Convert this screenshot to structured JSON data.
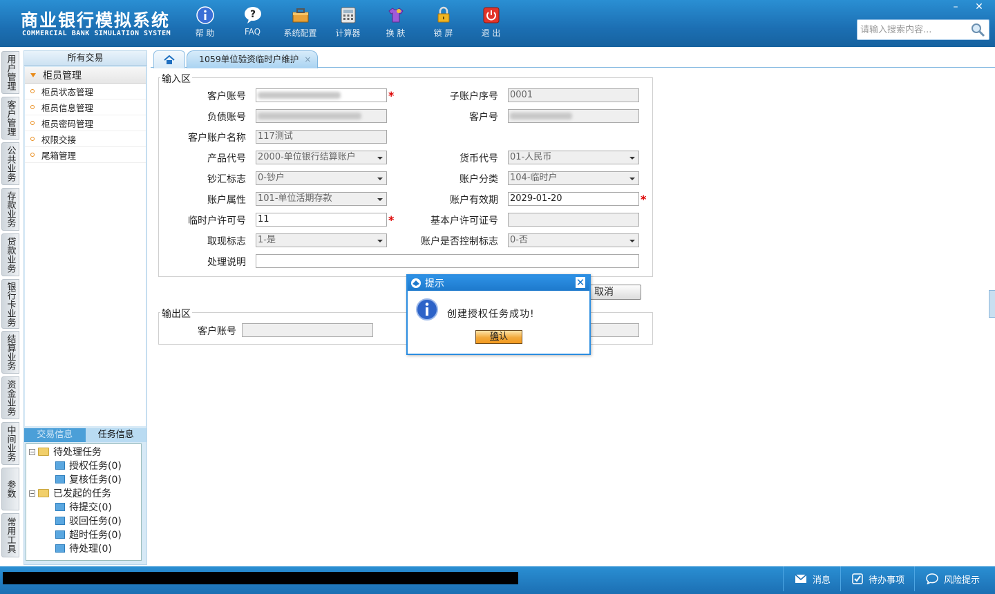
{
  "header": {
    "title_cn": "商业银行模拟系统",
    "title_en": "COMMERCIAL BANK SIMULATION SYSTEM",
    "toolbar": [
      {
        "label": "帮 助",
        "icon": "info-icon"
      },
      {
        "label": "FAQ",
        "icon": "faq-icon"
      },
      {
        "label": "系统配置",
        "icon": "toolbox-icon"
      },
      {
        "label": "计算器",
        "icon": "calculator-icon"
      },
      {
        "label": "换 肤",
        "icon": "shirt-icon"
      },
      {
        "label": "锁 屏",
        "icon": "lock-icon"
      },
      {
        "label": "退 出",
        "icon": "power-icon"
      }
    ],
    "search_placeholder": "请输入搜索内容...",
    "window_minimize": "–",
    "window_close": "✕"
  },
  "vtabs": [
    "用户管理",
    "客户管理",
    "公共业务",
    "存款业务",
    "贷款业务",
    "银行卡业务",
    "结算业务",
    "资金业务",
    "中间业务",
    "参数",
    "常用工具"
  ],
  "left_panel": {
    "title": "所有交易",
    "group": "柜员管理",
    "items": [
      "柜员状态管理",
      "柜员信息管理",
      "柜员密码管理",
      "权限交接",
      "尾箱管理"
    ],
    "tabs": [
      "交易信息",
      "任务信息"
    ],
    "tree": {
      "pending": "待处理任务",
      "pending_children": [
        "授权任务(0)",
        "复核任务(0)"
      ],
      "initiated": "已发起的任务",
      "initiated_children": [
        "待提交(0)",
        "驳回任务(0)",
        "超时任务(0)",
        "待处理(0)"
      ]
    }
  },
  "content_tab": {
    "title": "1059单位验资临时户维护",
    "close": "×"
  },
  "input_section": {
    "legend": "输入区",
    "labels": {
      "customer_account": "客户账号",
      "sub_account_seq": "子账户序号",
      "liability_account": "负债账号",
      "customer_no": "客户号",
      "account_name": "客户账户名称",
      "product_code": "产品代号",
      "currency_code": "货币代号",
      "cash_flag": "钞汇标志",
      "account_category": "账户分类",
      "account_attribute": "账户属性",
      "valid_date": "账户有效期",
      "temp_license": "临时户许可号",
      "basic_license": "基本户许可证号",
      "withdraw_flag": "取现标志",
      "controlled_flag": "账户是否控制标志",
      "remark": "处理说明"
    },
    "values": {
      "sub_account_seq": "0001",
      "account_name": "117测试",
      "product_code": "2000-单位银行结算账户",
      "currency_code": "01-人民币",
      "cash_flag": "0-钞户",
      "account_category": "104-临时户",
      "account_attribute": "101-单位活期存款",
      "valid_date": "2029-01-20",
      "temp_license": "11",
      "basic_license": "",
      "withdraw_flag": "1-是",
      "controlled_flag": "0-否",
      "remark": ""
    },
    "required_mark": "*"
  },
  "buttons": {
    "cancel": "取消"
  },
  "output_section": {
    "legend": "输出区",
    "customer_account_label": "客户账号",
    "customer_account_value": ""
  },
  "dialog": {
    "title": "提示",
    "close": "✕",
    "message": "创建授权任务成功!",
    "ok_prefix": "确",
    "ok_suffix": "认"
  },
  "statusbar": {
    "items": [
      {
        "label": "消息",
        "icon": "mail-icon"
      },
      {
        "label": "待办事项",
        "icon": "checkbox-icon"
      },
      {
        "label": "风险提示",
        "icon": "chat-bubble-icon"
      }
    ]
  },
  "colors": {
    "header_blue": "#1c6fb3",
    "dialog_blue": "#2b8de0",
    "required_red": "#dd0000",
    "accent_orange": "#e88a18"
  }
}
